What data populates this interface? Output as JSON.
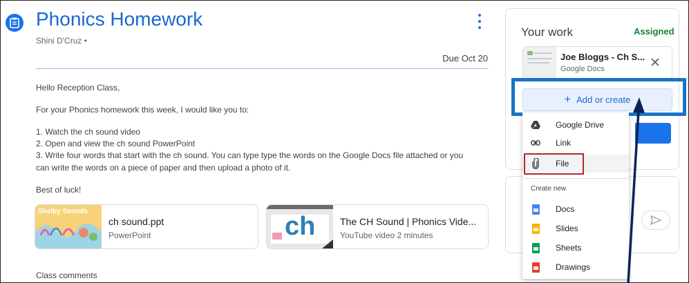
{
  "header": {
    "title": "Phonics Homework",
    "author": "Shini D'Cruz •",
    "due": "Due Oct 20"
  },
  "instructions": {
    "greeting": "Hello Reception Class,",
    "intro": "For your Phonics homework this week, I would like you to:",
    "step1": "1. Watch the ch sound video",
    "step2": "2. Open and view the ch sound PowerPoint",
    "step3a": "3. Write four words that start with the ch sound. You can type type the words on the Google Docs file attached or you",
    "step3b": "can write the words on a piece of paper and then upload a photo of it.",
    "signoff": "Best of luck!"
  },
  "attachments": [
    {
      "title": "ch sound.ppt",
      "subtitle": "PowerPoint",
      "thumb_text": "Shelby Sounds"
    },
    {
      "title": "The CH Sound | Phonics Vide...",
      "subtitle": "YouTube video  2 minutes",
      "thumb_text": "ch"
    }
  ],
  "comments": {
    "label": "Class comments"
  },
  "your_work": {
    "title": "Your work",
    "status": "Assigned",
    "file_name": "Joe Bloggs - Ch S...",
    "file_type": "Google Docs",
    "add_button": "Add or create",
    "add_symbol": "+"
  },
  "menu": {
    "items": [
      {
        "label": "Google Drive",
        "icon": "google-drive-icon"
      },
      {
        "label": "Link",
        "icon": "link-icon"
      },
      {
        "label": "File",
        "icon": "paperclip-icon"
      }
    ],
    "create_new_heading": "Create new",
    "create_items": [
      {
        "label": "Docs",
        "icon": "docs-icon",
        "color": "#4285f4"
      },
      {
        "label": "Slides",
        "icon": "slides-icon",
        "color": "#f4b400"
      },
      {
        "label": "Sheets",
        "icon": "sheets-icon",
        "color": "#0f9d58"
      },
      {
        "label": "Drawings",
        "icon": "drawings-icon",
        "color": "#db4437"
      }
    ]
  },
  "colors": {
    "brand_blue": "#1967d2",
    "assigned_green": "#188038",
    "focus_box": "#1a73c8",
    "red_box": "#b3282d",
    "arrow": "#0b2358"
  }
}
